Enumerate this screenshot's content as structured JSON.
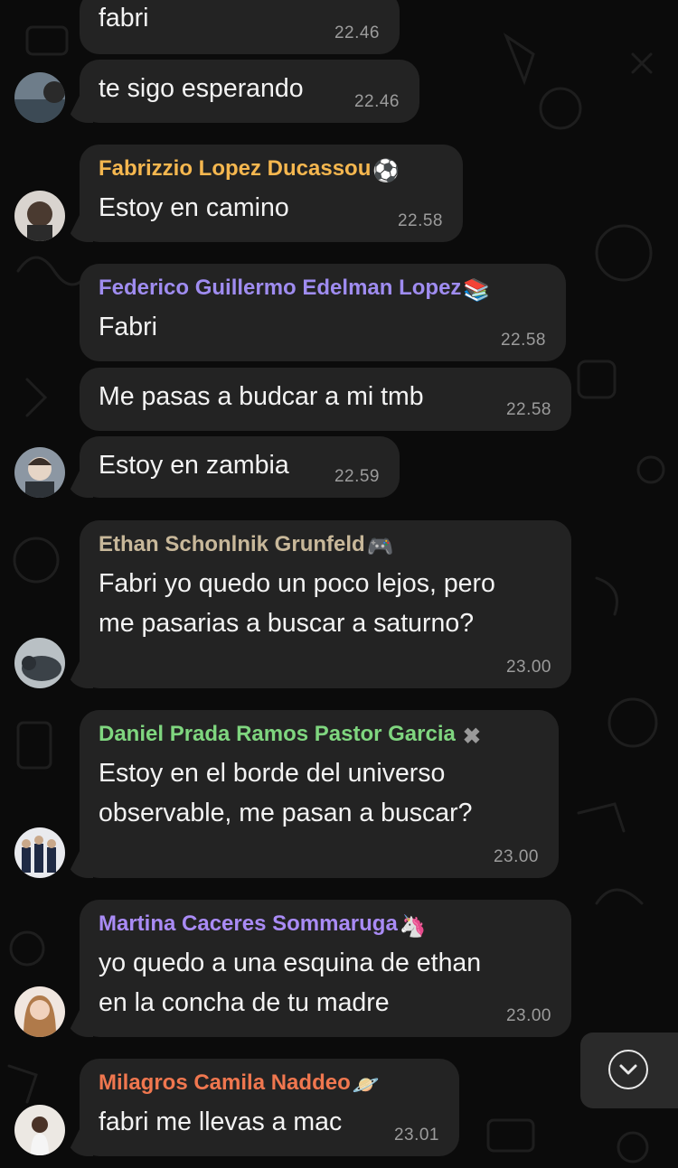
{
  "messages": [
    {
      "text": "fabri",
      "time": "22.46"
    },
    {
      "text": "te sigo esperando",
      "time": "22.46"
    },
    {
      "sender": "Fabrizzio Lopez Ducassou",
      "sender_color": "#f5b74f",
      "emoji": "soccer-ball-icon",
      "text": "Estoy en camino",
      "time": "22.58"
    },
    {
      "sender": "Federico Guillermo Edelman Lopez",
      "sender_color": "#9f8cf0",
      "emoji": "books-icon",
      "text": "Fabri",
      "time": "22.58"
    },
    {
      "text": "Me pasas a budcar a mi tmb",
      "time": "22.58"
    },
    {
      "text": "Estoy en zambia",
      "time": "22.59"
    },
    {
      "sender": "Ethan Schonlnik Grunfeld",
      "sender_color": "#c8b89a",
      "emoji": "game-controller-icon",
      "text": "Fabri yo quedo un poco lejos, pero\nme pasarias a buscar a saturno?",
      "time": "23.00"
    },
    {
      "sender": "Daniel Prada Ramos Pastor Garcia",
      "sender_color": "#7fd67f",
      "emoji": "cross-mark-icon",
      "text": "Estoy en el borde del universo\nobservable, me pasan a buscar?",
      "time": "23.00"
    },
    {
      "sender": "Martina Caceres Sommaruga",
      "sender_color": "#a98bf5",
      "emoji": "unicorn-icon",
      "text": "yo quedo a una esquina de ethan\nen la concha de tu madre",
      "time": "23.00"
    },
    {
      "sender": "Milagros Camila Naddeo",
      "sender_color": "#f0774f",
      "emoji": "ringed-planet-icon",
      "text": "fabri me llevas a mac",
      "time": "23.01"
    }
  ],
  "scroll_button": {
    "icon": "chevron-down-icon"
  }
}
